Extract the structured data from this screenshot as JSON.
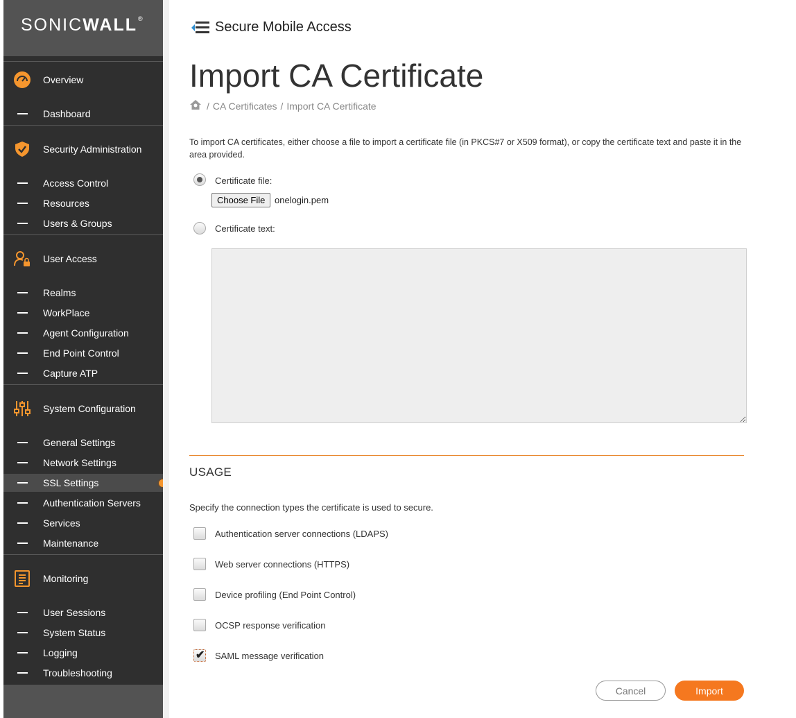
{
  "brand": {
    "logo_sonic": "SONIC",
    "logo_wall": "WALL",
    "logo_reg": "®",
    "accent": "#f5962e"
  },
  "sidebar": {
    "sections": [
      {
        "label": "Overview",
        "icon": "gauge-icon",
        "items": [
          {
            "label": "Dashboard"
          }
        ]
      },
      {
        "label": "Security Administration",
        "icon": "shield-check-icon",
        "items": [
          {
            "label": "Access Control"
          },
          {
            "label": "Resources"
          },
          {
            "label": "Users & Groups"
          }
        ]
      },
      {
        "label": "User Access",
        "icon": "user-lock-icon",
        "items": [
          {
            "label": "Realms"
          },
          {
            "label": "WorkPlace"
          },
          {
            "label": "Agent Configuration"
          },
          {
            "label": "End Point Control"
          },
          {
            "label": "Capture ATP"
          }
        ]
      },
      {
        "label": "System Configuration",
        "icon": "sliders-icon",
        "items": [
          {
            "label": "General Settings"
          },
          {
            "label": "Network Settings"
          },
          {
            "label": "SSL Settings",
            "active": true
          },
          {
            "label": "Authentication Servers"
          },
          {
            "label": "Services"
          },
          {
            "label": "Maintenance"
          }
        ]
      },
      {
        "label": "Monitoring",
        "icon": "report-icon",
        "items": [
          {
            "label": "User Sessions"
          },
          {
            "label": "System Status"
          },
          {
            "label": "Logging"
          },
          {
            "label": "Troubleshooting"
          }
        ]
      }
    ]
  },
  "header": {
    "app_name": "Secure Mobile Access"
  },
  "page": {
    "title": "Import CA Certificate",
    "breadcrumb": [
      "CA Certificates",
      "Import CA Certificate"
    ],
    "intro": "To import CA certificates, either choose a file to import a certificate file (in PKCS#7 or X509 format), or copy the certificate text and paste it in the area provided.",
    "cert_file_label": "Certificate file:",
    "choose_file_label": "Choose File",
    "file_name": "onelogin.pem",
    "cert_text_label": "Certificate text:",
    "cert_text_value": "",
    "selected_source": "file"
  },
  "usage": {
    "title": "USAGE",
    "description": "Specify the connection types the certificate is used to secure.",
    "options": [
      {
        "label": "Authentication server connections (LDAPS)",
        "checked": false
      },
      {
        "label": "Web server connections (HTTPS)",
        "checked": false
      },
      {
        "label": "Device profiling (End Point Control)",
        "checked": false
      },
      {
        "label": "OCSP response verification",
        "checked": false
      },
      {
        "label": "SAML message verification",
        "checked": true
      }
    ]
  },
  "actions": {
    "cancel_label": "Cancel",
    "import_label": "Import"
  }
}
